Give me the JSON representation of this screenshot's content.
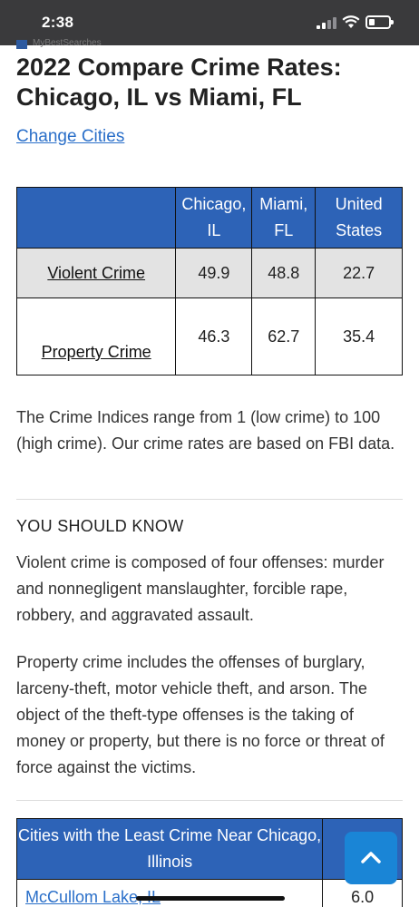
{
  "status_bar": {
    "time": "2:38",
    "icons": [
      "cellular-signal-icon",
      "wifi-icon",
      "battery-icon"
    ]
  },
  "header": {
    "site_name": "MyBestSearches"
  },
  "title": {
    "line1": "2022 Compare Crime Rates:",
    "line2": "Chicago, IL vs Miami, FL"
  },
  "change_cities_link": "Change Cities",
  "crime_table": {
    "columns": [
      "",
      "Chicago, IL",
      "Miami, FL",
      "United States"
    ],
    "rows": [
      {
        "label": "Violent Crime",
        "values": [
          "49.9",
          "48.8",
          "22.7"
        ]
      },
      {
        "label": "Property Crime",
        "values": [
          "46.3",
          "62.7",
          "35.4"
        ]
      }
    ]
  },
  "indices_note": "The Crime Indices range from 1 (low crime) to 100 (high crime). Our crime rates are based on FBI data.",
  "you_should_know": {
    "heading": "YOU SHOULD KNOW",
    "violent_text": "Violent crime is composed of four offenses: murder and nonnegligent manslaughter, forcible rape, robbery, and aggravated assault.",
    "property_text": "Property crime includes the offenses of burglary, larceny-theft, motor vehicle theft, and arson. The object of the theft-type offenses is the taking of money or property, but there is no force or threat of force against the victims."
  },
  "least_crime_table": {
    "header": "Cities with the Least Crime Near Chicago, Illinois",
    "rows": [
      {
        "city": "McCullom Lake, IL",
        "value": "6.0"
      }
    ]
  },
  "colors": {
    "table_header": "#2d63b7",
    "link": "#2a6fc9",
    "back_to_top": "#1a85d6",
    "status_bar": "#3a3a3c"
  }
}
